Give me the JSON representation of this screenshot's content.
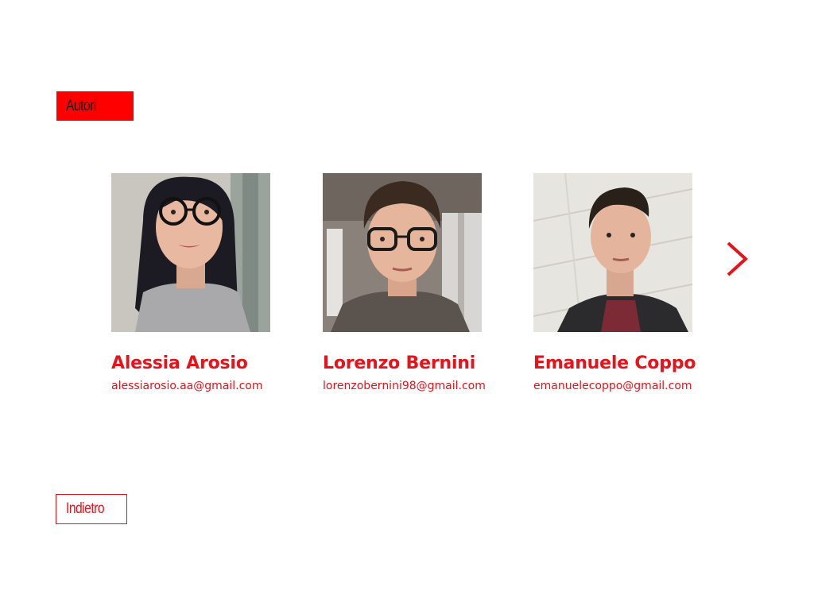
{
  "section": {
    "label": "Autori"
  },
  "authors": [
    {
      "name": "Alessia Arosio",
      "email": "alessiarosio.aa@gmail.com",
      "photo_icon": "portrait-woman-glasses"
    },
    {
      "name": "Lorenzo Bernini",
      "email": "lorenzobernini98@gmail.com",
      "photo_icon": "portrait-man-glasses"
    },
    {
      "name": "Emanuele Coppo",
      "email": "emanuelecoppo@gmail.com",
      "photo_icon": "portrait-man-jacket"
    }
  ],
  "navigation": {
    "next_icon": "chevron-right-icon",
    "back_label": "Indietro"
  },
  "colors": {
    "accent": "#e8121a",
    "label_bg": "#ff0000",
    "background": "#ffffff"
  }
}
